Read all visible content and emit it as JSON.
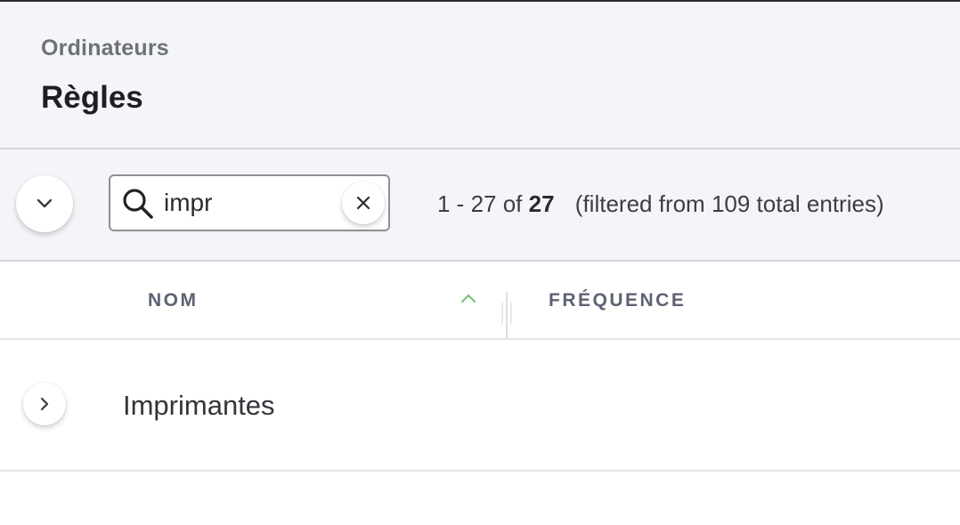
{
  "header": {
    "breadcrumb": "Ordinateurs",
    "title": "Règles"
  },
  "toolbar": {
    "collapse_icon": "chevron-down-icon",
    "search": {
      "value": "impr",
      "icon": "search-icon",
      "clear_icon": "close-icon"
    },
    "pagination": {
      "range": "1 - 27 of",
      "total": "27",
      "filtered": "(filtered from 109 total entries)"
    }
  },
  "table": {
    "columns": [
      {
        "label": "NOM",
        "sorted": "ascending",
        "sort_icon": "chevron-up-icon"
      },
      {
        "label": "FRÉQUENCE"
      }
    ],
    "rows": [
      {
        "name": "Imprimantes",
        "expand_icon": "chevron-right-icon"
      }
    ]
  },
  "colors": {
    "header_bg": "#f4f5f8",
    "sort_accent": "#7cc576",
    "column_label": "#5e6272"
  }
}
